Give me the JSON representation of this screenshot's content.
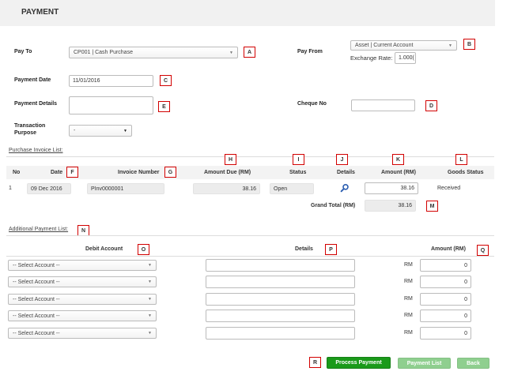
{
  "header": {
    "title": "PAYMENT"
  },
  "form": {
    "pay_to_label": "Pay To",
    "pay_to_value": "CP001 | Cash Purchase",
    "pay_from_label": "Pay From",
    "pay_from_value": "Asset | Current Account",
    "exchange_rate_label": "Exchange Rate:",
    "exchange_rate_value": "1.000(",
    "payment_date_label": "Payment Date",
    "payment_date_value": "11/01/2016",
    "payment_details_label": "Payment Details",
    "payment_details_value": "",
    "cheque_no_label": "Cheque No",
    "cheque_no_value": "",
    "transaction_purpose_label_1": "Transaction",
    "transaction_purpose_label_2": "Purpose",
    "transaction_purpose_value": "-"
  },
  "markers": [
    "A",
    "B",
    "C",
    "D",
    "E",
    "F",
    "G",
    "H",
    "I",
    "J",
    "K",
    "L",
    "M",
    "N",
    "O",
    "P",
    "Q",
    "R"
  ],
  "invoice": {
    "title": "Purchase Invoice List:",
    "headers": {
      "no": "No",
      "date": "Date",
      "invoice_number": "Invoice Number",
      "amount_due": "Amount Due (RM)",
      "status": "Status",
      "details": "Details",
      "amount": "Amount (RM)",
      "goods_status": "Goods Status"
    },
    "rows": [
      {
        "no": "1",
        "date": "09 Dec 2016",
        "invoice_number": "PInv0000001",
        "amount_due": "38.16",
        "status": "Open",
        "amount": "38.16",
        "goods_status": "Received"
      }
    ],
    "grand_total_label": "Grand Total (RM)",
    "grand_total_value": "38.16"
  },
  "additional": {
    "title": "Additional Payment List:",
    "headers": {
      "debit_account": "Debit Account",
      "details": "Details",
      "amount": "Amount (RM)"
    },
    "rows": [
      {
        "account": "-- Select Account --",
        "details": "",
        "currency": "RM",
        "amount": "0"
      },
      {
        "account": "-- Select Account --",
        "details": "",
        "currency": "RM",
        "amount": "0"
      },
      {
        "account": "-- Select Account --",
        "details": "",
        "currency": "RM",
        "amount": "0"
      },
      {
        "account": "-- Select Account --",
        "details": "",
        "currency": "RM",
        "amount": "0"
      },
      {
        "account": "-- Select Account --",
        "details": "",
        "currency": "RM",
        "amount": "0"
      }
    ]
  },
  "buttons": {
    "process_payment": "Process Payment",
    "payment_list": "Payment List",
    "back": "Back"
  },
  "colors": {
    "marker_border": "#d20000",
    "primary_button": "#1a9a1a",
    "light_button": "#8fcf8f"
  }
}
